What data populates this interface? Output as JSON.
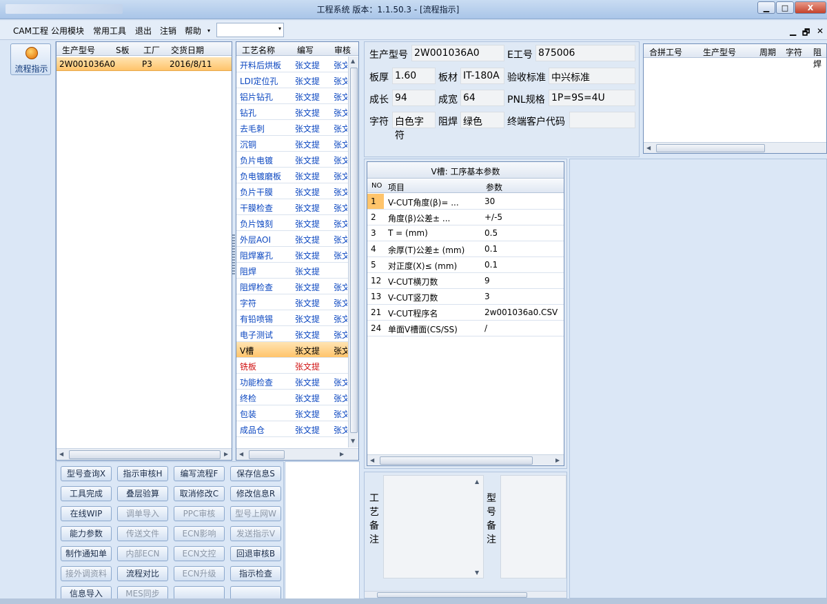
{
  "window": {
    "title": "工程系统   版本：1.1.50.3 - [流程指示]",
    "min": "▁",
    "max": "□",
    "close": "X"
  },
  "menu": {
    "items": [
      "CAM工程",
      "公用模块",
      "常用工具",
      "退出",
      "注销",
      "帮助"
    ],
    "combo_arrow": "▾",
    "mdi": [
      "▁",
      "🗗",
      "✕"
    ]
  },
  "leftstrip": {
    "flow_label": "流程指示"
  },
  "orders": {
    "headers": [
      "生产型号",
      "S板",
      "工厂",
      "交货日期"
    ],
    "rows": [
      [
        "2W001036A0",
        "",
        "P3",
        "2016/8/11"
      ]
    ]
  },
  "process": {
    "headers": [
      "工艺名称",
      "编写",
      "审核"
    ],
    "rows": [
      [
        "开料后烘板",
        "张文提",
        "张文"
      ],
      [
        "LDI定位孔",
        "张文提",
        "张文"
      ],
      [
        "铝片钻孔",
        "张文提",
        "张文"
      ],
      [
        "钻孔",
        "张文提",
        "张文"
      ],
      [
        "去毛刺",
        "张文提",
        "张文"
      ],
      [
        "沉铜",
        "张文提",
        "张文"
      ],
      [
        "负片电镀",
        "张文提",
        "张文"
      ],
      [
        "负电镀磨板",
        "张文提",
        "张文"
      ],
      [
        "负片干膜",
        "张文提",
        "张文"
      ],
      [
        "干膜检查",
        "张文提",
        "张文"
      ],
      [
        "负片蚀刻",
        "张文提",
        "张文"
      ],
      [
        "外层AOI",
        "张文提",
        "张文"
      ],
      [
        "阻焊塞孔",
        "张文提",
        "张文"
      ],
      [
        "阻焊",
        "张文提",
        ""
      ],
      [
        "阻焊检查",
        "张文提",
        "张文"
      ],
      [
        "字符",
        "张文提",
        "张文"
      ],
      [
        "有铅喷锡",
        "张文提",
        "张文"
      ],
      [
        "电子测试",
        "张文提",
        "张文"
      ],
      [
        "V槽",
        "张文提",
        "张文"
      ],
      [
        "铣板",
        "张文提",
        ""
      ],
      [
        "功能检查",
        "张文提",
        "张文"
      ],
      [
        "终检",
        "张文提",
        "张文"
      ],
      [
        "包装",
        "张文提",
        "张文"
      ],
      [
        "成品仓",
        "张文提",
        "张文"
      ]
    ],
    "selected_index": 18,
    "red_index": 19
  },
  "buttons": [
    [
      "型号查询X",
      "指示审核H",
      "编写流程F",
      "保存信息S"
    ],
    [
      "工具完成",
      "叠层验算",
      "取消修改C",
      "修改信息R"
    ],
    [
      "在线WIP",
      "调单导入",
      "PPC审核",
      "型号上网W"
    ],
    [
      "能力参数",
      "传送文件",
      "ECN影响",
      "发送指示V"
    ],
    [
      "制作通知单",
      "内部ECN",
      "ECN文控",
      "回退审核B"
    ],
    [
      "接外调资料",
      "流程对比",
      "ECN升级",
      "指示检查"
    ],
    [
      "信息导入",
      "MES同步",
      "",
      ""
    ]
  ],
  "disabled_buttons": [
    "调单导入",
    "PPC审核",
    "型号上网W",
    "传送文件",
    "ECN影响",
    "发送指示V",
    "内部ECN",
    "ECN文控",
    "接外调资料",
    "ECN升级",
    "MES同步"
  ],
  "info": {
    "labels": {
      "model": "生产型号",
      "eno": "E工号",
      "thick": "板厚",
      "mat": "板材",
      "std": "验收标准",
      "len": "成长",
      "wid": "成宽",
      "pnl": "PNL规格",
      "char": "字符",
      "mask": "阻焊",
      "cust": "终端客户代码"
    },
    "values": {
      "model": "2W001036A0",
      "eno": "875006",
      "thick": "1.60",
      "mat": "IT-180A",
      "std": "中兴标准",
      "len": "94",
      "wid": "64",
      "pnl": "1P=9S=4U",
      "char": "白色字符",
      "mask": "绿色",
      "cust": ""
    }
  },
  "merge": {
    "headers": [
      "合拼工号",
      "生产型号",
      "周期",
      "字符",
      "阻焊"
    ]
  },
  "params": {
    "title": "V槽: 工序基本参数",
    "headers": [
      "NO",
      "项目",
      "参数"
    ],
    "rows": [
      [
        "1",
        "V-CUT角度(β)=  ...",
        "30"
      ],
      [
        "2",
        "角度(β)公差±  ...",
        "+/-5"
      ],
      [
        "3",
        "T =  (mm)",
        "0.5"
      ],
      [
        "4",
        "余厚(T)公差±  (mm)",
        "0.1"
      ],
      [
        "5",
        "对正度(X)≤ (mm)",
        "0.1"
      ],
      [
        "12",
        "V-CUT横刀数",
        "9"
      ],
      [
        "13",
        "V-CUT竖刀数",
        "3"
      ],
      [
        "21",
        "V-CUT程序名",
        "2w001036a0.CSV"
      ],
      [
        "24",
        "单面V槽面(CS/SS)",
        "/"
      ]
    ]
  },
  "remarks": {
    "process_label": "工艺备注",
    "model_label": "型号备注"
  },
  "colors": {
    "accent": "#ffc46b",
    "link": "#0a46c0",
    "warn": "#d01010"
  }
}
